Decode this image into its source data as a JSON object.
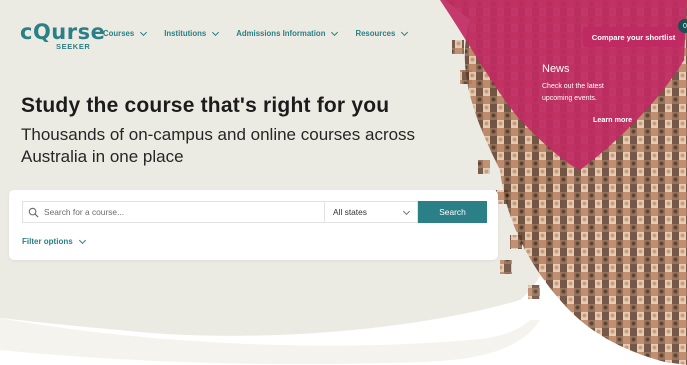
{
  "header": {
    "logo_main": "cQurse",
    "logo_sub": "SEEKER",
    "nav": [
      {
        "label": "Courses"
      },
      {
        "label": "Institutions"
      },
      {
        "label": "Admissions Information"
      },
      {
        "label": "Resources"
      }
    ],
    "compare_label": "Compare your shortlist",
    "corner_badge": "0"
  },
  "news": {
    "title": "News",
    "description": "Check out the latest upcoming events.",
    "link_label": "Learn more"
  },
  "hero": {
    "title": "Study the course that's right for you",
    "subtitle": "Thousands of on-campus and online courses across Australia in one place"
  },
  "search": {
    "placeholder": "Search for a course...",
    "state_selected": "All states",
    "button_label": "Search",
    "filter_label": "Filter options"
  },
  "colors": {
    "brand_teal": "#2b7f86",
    "accent_magenta": "#c02a62",
    "background_cream": "#ecebe3"
  }
}
